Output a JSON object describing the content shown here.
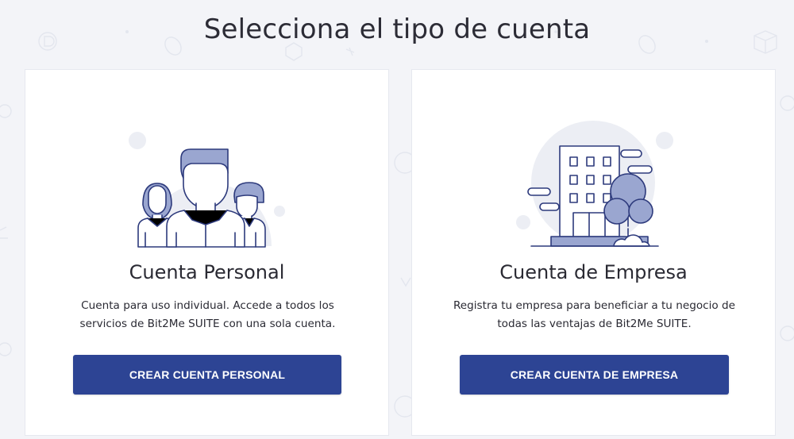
{
  "page": {
    "title": "Selecciona el tipo de cuenta"
  },
  "colors": {
    "primary": "#2d4494",
    "illustration_fill": "#9aa6d0",
    "illustration_stroke": "#2d3a7c",
    "background": "#f3f4f8"
  },
  "cards": [
    {
      "title": "Cuenta Personal",
      "description": "Cuenta para uso individual. Accede a todos los servicios de Bit2Me SUITE con una sola cuenta.",
      "button_label": "CREAR CUENTA PERSONAL",
      "illustration": "people-icon"
    },
    {
      "title": "Cuenta de Empresa",
      "description": "Registra tu empresa para beneficiar a tu negocio de todas las ventajas de Bit2Me SUITE.",
      "button_label": "CREAR CUENTA DE EMPRESA",
      "illustration": "building-icon"
    }
  ]
}
